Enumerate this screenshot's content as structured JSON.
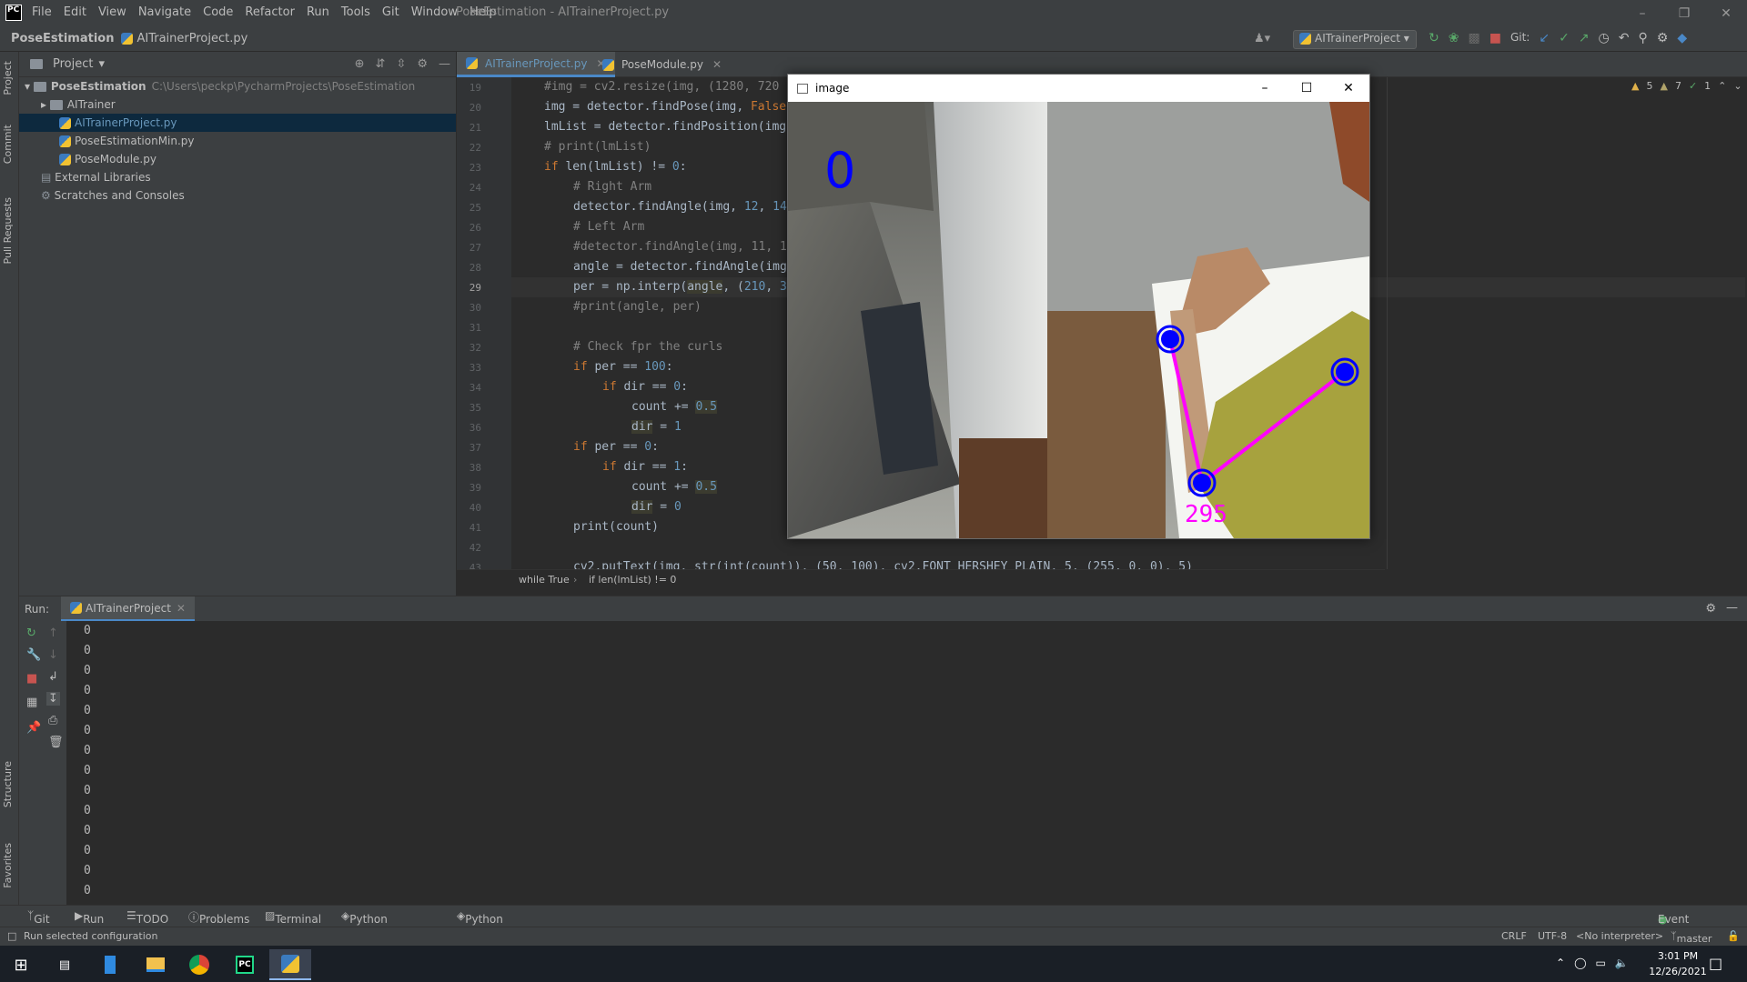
{
  "menubar": {
    "logo": "PC",
    "items": [
      "File",
      "Edit",
      "View",
      "Navigate",
      "Code",
      "Refactor",
      "Run",
      "Tools",
      "Git",
      "Window",
      "Help"
    ],
    "title": "PoseEstimation - AITrainerProject.py"
  },
  "navbar": {
    "project": "PoseEstimation",
    "file": "AITrainerProject.py",
    "run_config": "AITrainerProject",
    "git_label": "Git:"
  },
  "sidebar_tabs": [
    "Project",
    "Commit",
    "Pull Requests",
    "Structure",
    "Favorites"
  ],
  "project_panel": {
    "title": "Project",
    "tree": [
      {
        "label": "PoseEstimation",
        "path": "C:\\Users\\peckp\\PycharmProjects\\PoseEstimation"
      },
      {
        "label": "AITrainer"
      },
      {
        "label": "AITrainerProject.py"
      },
      {
        "label": "PoseEstimationMin.py"
      },
      {
        "label": "PoseModule.py"
      },
      {
        "label": "External Libraries"
      },
      {
        "label": "Scratches and Consoles"
      }
    ]
  },
  "editor": {
    "tabs": [
      {
        "label": "AITrainerProject.py"
      },
      {
        "label": "PoseModule.py"
      }
    ],
    "line_numbers": [
      "19",
      "20",
      "21",
      "22",
      "23",
      "24",
      "25",
      "26",
      "27",
      "28",
      "29",
      "30",
      "31",
      "32",
      "33",
      "34",
      "35",
      "36",
      "37",
      "38",
      "39",
      "40",
      "41",
      "42",
      "43"
    ],
    "inspections": {
      "warn_a": "5",
      "warn_b": "7",
      "ok": "1"
    },
    "breadcrumb": [
      "while True",
      "if len(lmList) != 0"
    ],
    "code_tail": "cv2.putText(img, str(int(count)), (50, 100), cv2.FONT_HERSHEY_PLAIN, 5, (255, 0, 0), 5)"
  },
  "image_window": {
    "title": "image",
    "count_overlay": "0",
    "angle_overlay": "295"
  },
  "run_panel": {
    "label": "Run:",
    "tab": "AITrainerProject",
    "output": [
      "0",
      "0",
      "0",
      "0",
      "0",
      "0",
      "0",
      "0",
      "0",
      "0",
      "0",
      "0",
      "0",
      "0"
    ]
  },
  "bottom_tabs": [
    "Git",
    "Run",
    "TODO",
    "Problems",
    "Terminal",
    "Python Packages",
    "Python Console",
    "Event Log"
  ],
  "status": {
    "message": "Run selected configuration",
    "line_sep": "CRLF",
    "encoding": "UTF-8",
    "interpreter": "<No interpreter>",
    "branch": "master"
  },
  "taskbar": {
    "time": "3:01 PM",
    "date": "12/26/2021"
  },
  "colors": {
    "accent": "#4a88c7",
    "keyword": "#cc7832",
    "number": "#6897bb",
    "comment": "#808080",
    "pose_line": "#ff00ff",
    "pose_joint": "#0000ff"
  }
}
